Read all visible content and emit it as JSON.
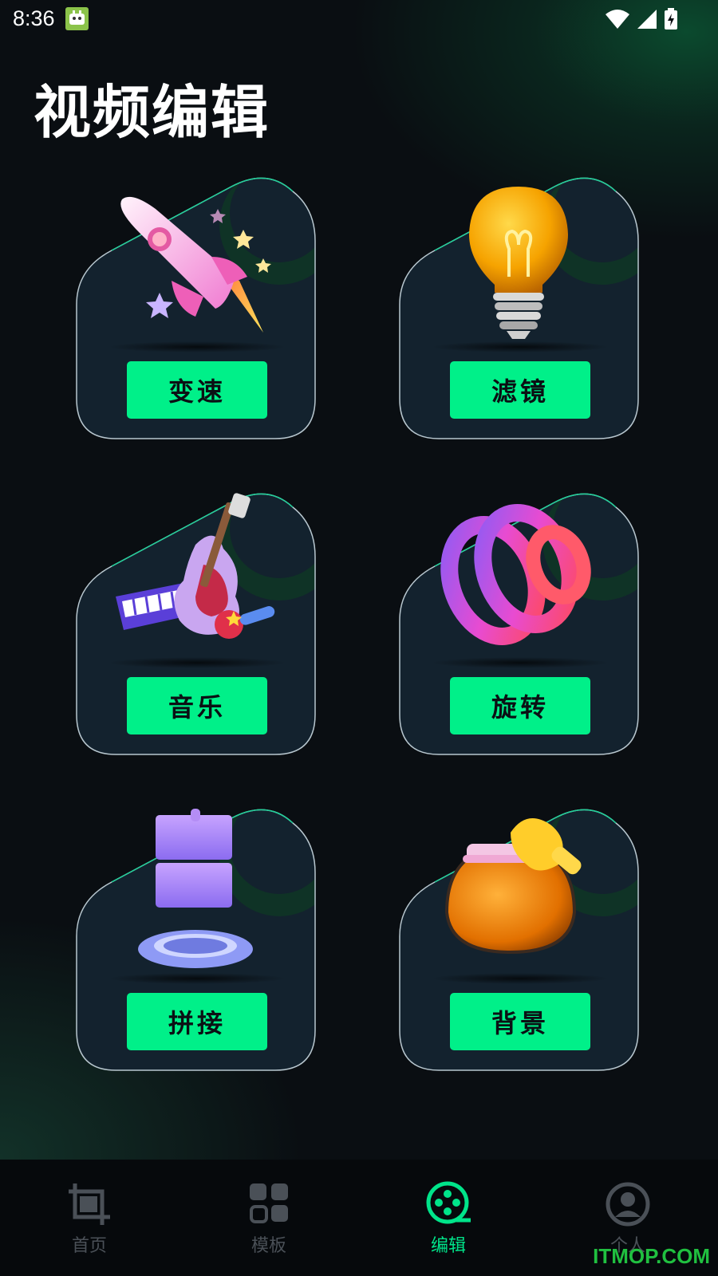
{
  "status_bar": {
    "time": "8:36",
    "icons": [
      "app-notification-icon",
      "wifi-icon",
      "signal-icon",
      "battery-charging-icon"
    ]
  },
  "page": {
    "title": "视频编辑"
  },
  "tools": [
    {
      "label": "变速",
      "icon": "rocket-icon"
    },
    {
      "label": "滤镜",
      "icon": "lightbulb-icon"
    },
    {
      "label": "音乐",
      "icon": "guitar-keyboard-icon"
    },
    {
      "label": "旋转",
      "icon": "spiral-icon"
    },
    {
      "label": "拼接",
      "icon": "stacked-blocks-icon"
    },
    {
      "label": "背景",
      "icon": "honey-jar-icon"
    }
  ],
  "bottom_nav": {
    "items": [
      {
        "label": "首页",
        "icon": "crop-icon",
        "active": false
      },
      {
        "label": "模板",
        "icon": "grid-icon",
        "active": false
      },
      {
        "label": "编辑",
        "icon": "film-reel-icon",
        "active": true
      },
      {
        "label": "个人",
        "icon": "user-icon",
        "active": false
      }
    ]
  },
  "watermark": "ITMOP.COM",
  "colors": {
    "accent": "#00f089",
    "background": "#0a0e12",
    "card": "#13222e",
    "nav_inactive": "#4a5057"
  }
}
